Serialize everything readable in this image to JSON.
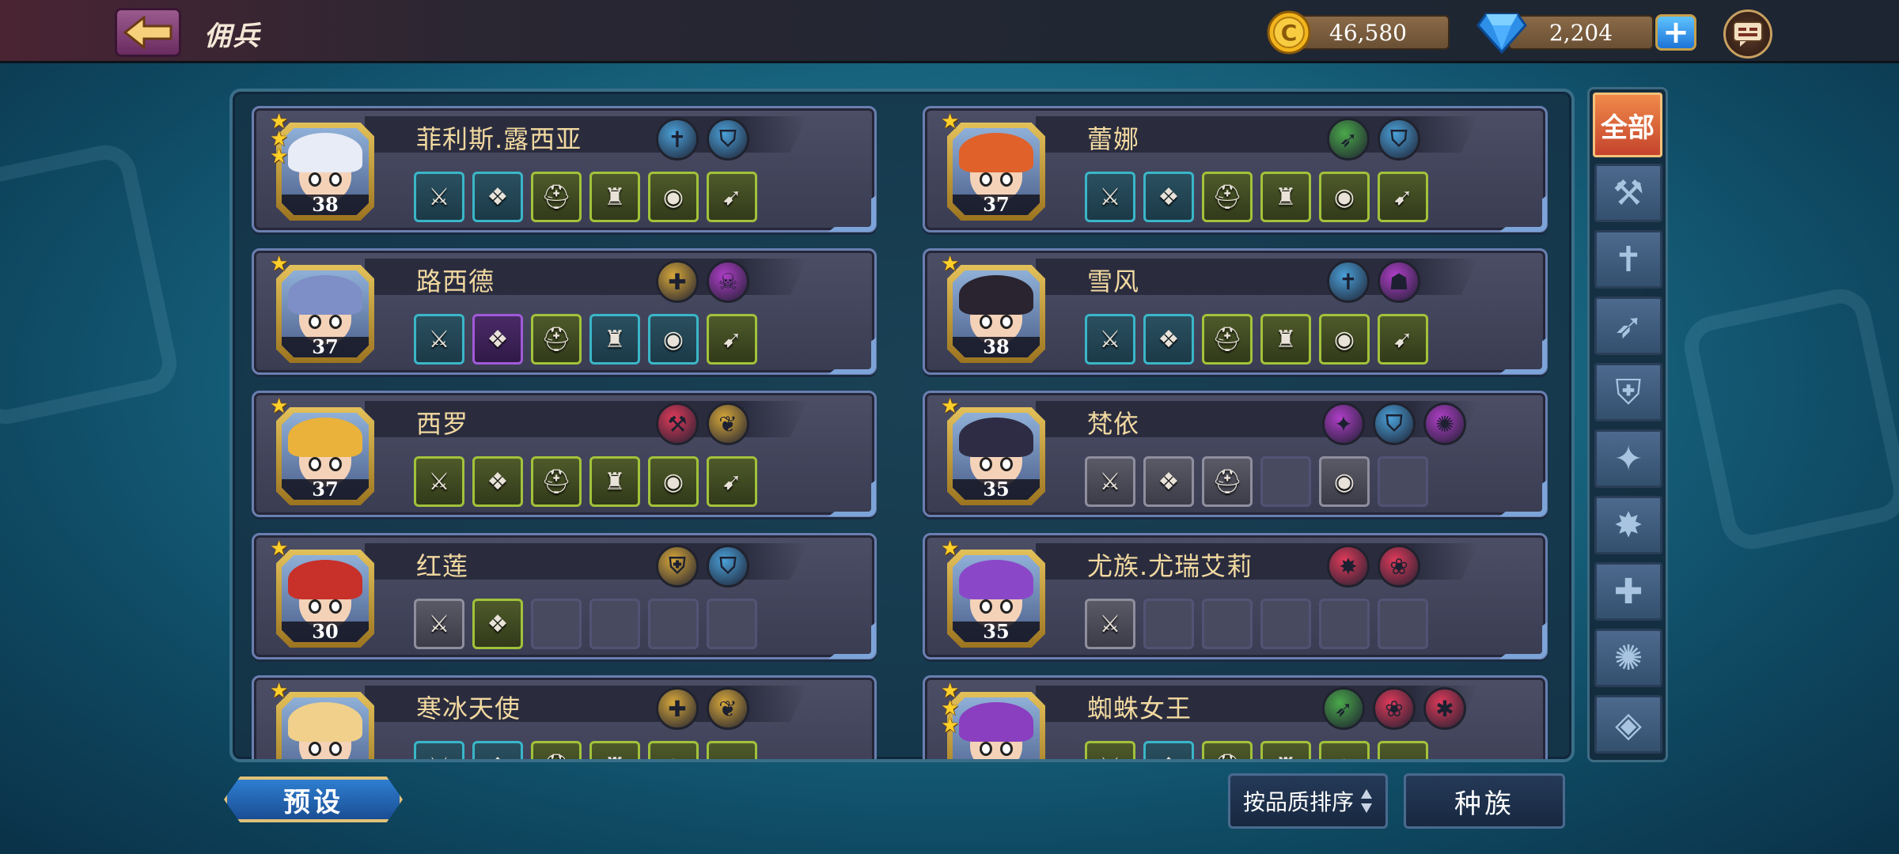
{
  "header": {
    "title": "佣兵",
    "gold": "46,580",
    "diamonds": "2,204"
  },
  "heroes": [
    {
      "name": "菲利斯.露西亚",
      "level": "38",
      "stars": 3,
      "hair": "#e8ecf6",
      "traits": [
        "sword-class",
        "helmet-race"
      ],
      "items": [
        "teal",
        "teal",
        "green",
        "green",
        "green",
        "green"
      ]
    },
    {
      "name": "蕾娜",
      "level": "37",
      "stars": 1,
      "hair": "#e0612a",
      "traits": [
        "bow-class",
        "helmet-race"
      ],
      "items": [
        "teal",
        "teal",
        "green",
        "green",
        "green",
        "green"
      ]
    },
    {
      "name": "路西德",
      "level": "37",
      "stars": 1,
      "hair": "#7e8ec6",
      "traits": [
        "cross-class",
        "demon-race"
      ],
      "items": [
        "teal",
        "purple",
        "green",
        "teal",
        "teal",
        "green"
      ]
    },
    {
      "name": "雪风",
      "level": "38",
      "stars": 1,
      "hair": "#2a2430",
      "traits": [
        "sword-class",
        "beast-race"
      ],
      "items": [
        "teal",
        "teal",
        "green",
        "green",
        "green",
        "green"
      ]
    },
    {
      "name": "西罗",
      "level": "37",
      "stars": 1,
      "hair": "#eab23a",
      "traits": [
        "hammer-class",
        "wing-race"
      ],
      "items": [
        "green",
        "green",
        "green",
        "green",
        "green",
        "green"
      ]
    },
    {
      "name": "梵依",
      "level": "35",
      "stars": 1,
      "hair": "#2e2c44",
      "traits": [
        "shuriken-class",
        "helmet-race",
        "rune-race"
      ],
      "items": [
        "grey",
        "grey",
        "grey",
        "empty",
        "grey",
        "empty"
      ]
    },
    {
      "name": "红莲",
      "level": "30",
      "stars": 1,
      "hair": "#c8302a",
      "traits": [
        "shield-class",
        "helmet-race"
      ],
      "items": [
        "grey",
        "green",
        "empty",
        "empty",
        "empty",
        "empty"
      ]
    },
    {
      "name": "尤族.尤瑞艾莉",
      "level": "35",
      "stars": 1,
      "hair": "#8a48c8",
      "traits": [
        "claw-class",
        "paw-race"
      ],
      "items": [
        "grey",
        "empty",
        "empty",
        "empty",
        "empty",
        "empty"
      ]
    },
    {
      "name": "寒冰天使",
      "level": "",
      "stars": 1,
      "hair": "#f0d08a",
      "traits": [
        "cross-class",
        "wing-race"
      ],
      "items": [
        "teal",
        "teal",
        "green",
        "green",
        "green",
        "green"
      ]
    },
    {
      "name": "蜘蛛女王",
      "level": "",
      "stars": 3,
      "hair": "#8a3ec0",
      "traits": [
        "bow-class",
        "paw-race",
        "spider-race"
      ],
      "items": [
        "green",
        "teal",
        "green",
        "green",
        "green",
        "green"
      ]
    }
  ],
  "filters": {
    "all_label": "全部",
    "icons": [
      "hammer-icon",
      "sword-totem-icon",
      "bow-icon",
      "shield-icon",
      "shuriken-icon",
      "claw-icon",
      "cross-icon",
      "swirl-icon",
      "circle-icon"
    ]
  },
  "footer": {
    "preset_label": "预设",
    "sort_label": "按品质排序",
    "race_label": "种族"
  },
  "colors": {
    "trait_blue": "#4aa0d8",
    "trait_green": "#4aa84a",
    "trait_gold": "#d8a83a",
    "trait_purple": "#b03ec8",
    "trait_red": "#e03a5a"
  }
}
